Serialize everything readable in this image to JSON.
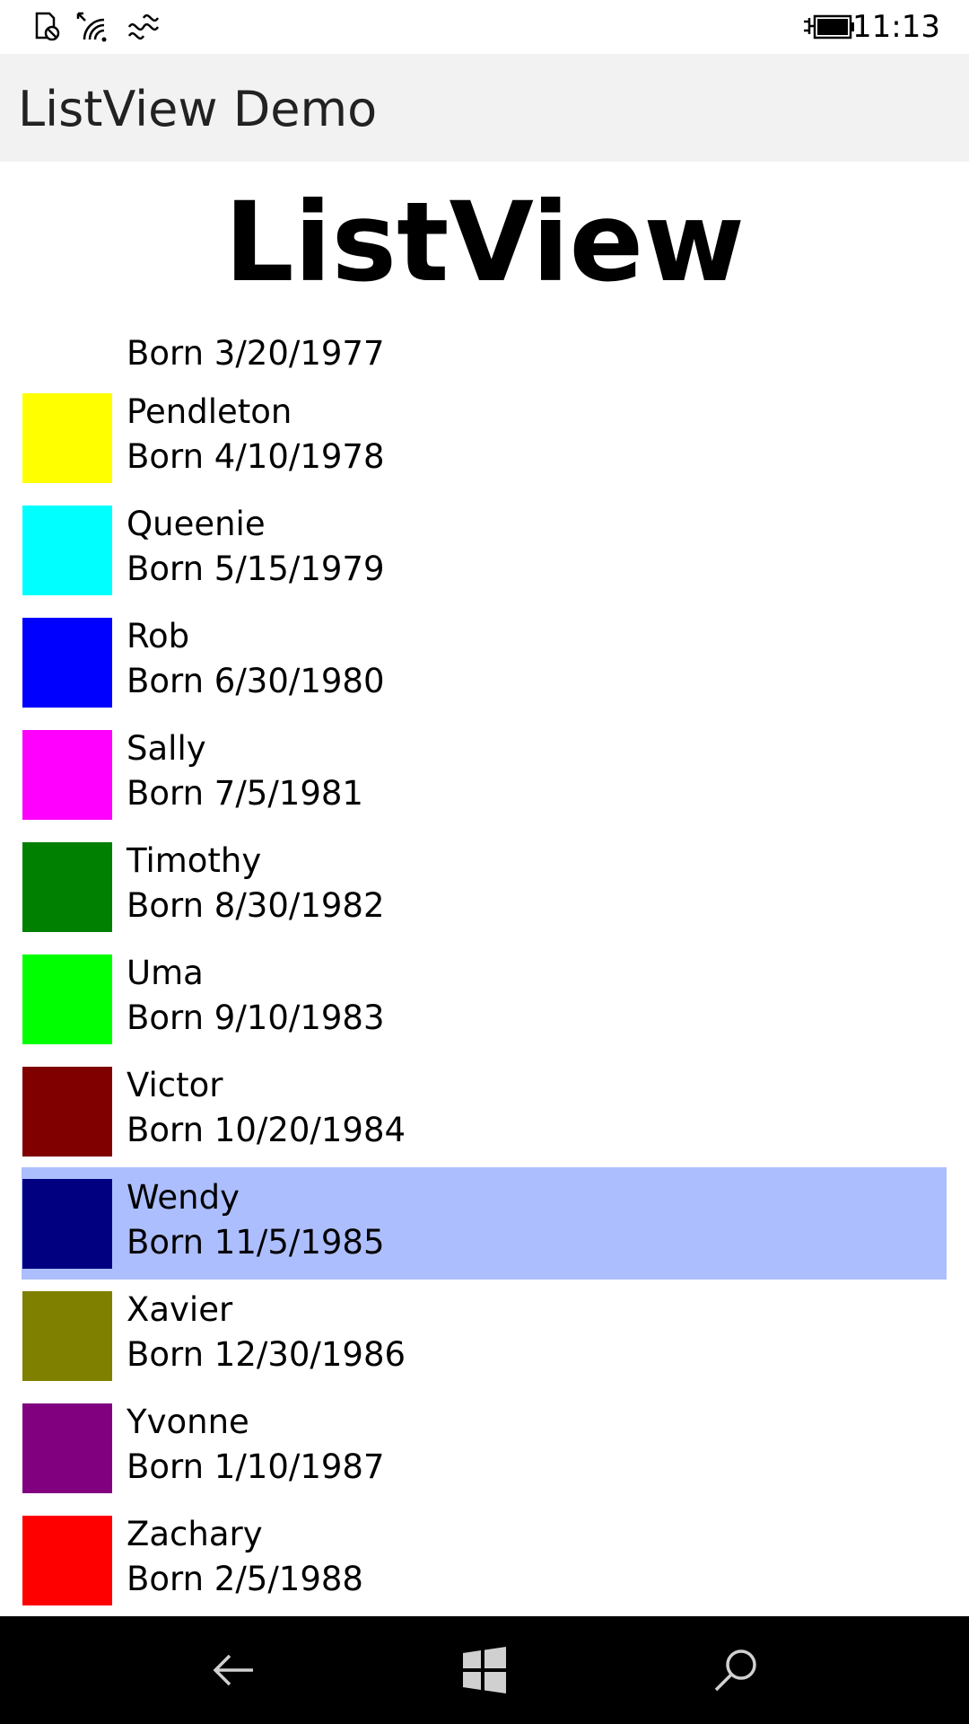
{
  "status_bar": {
    "time": "11:13",
    "icons": [
      "notification-icon",
      "wifi-icon",
      "cellular-icon",
      "battery-charging-icon"
    ]
  },
  "app": {
    "title": "ListView Demo"
  },
  "page": {
    "header": "ListView"
  },
  "list": {
    "partial_item_born": "Born 3/20/1977",
    "items": [
      {
        "name": "Pendleton",
        "born": "Born 4/10/1978",
        "color": "#ffff00"
      },
      {
        "name": "Queenie",
        "born": "Born 5/15/1979",
        "color": "#00ffff"
      },
      {
        "name": "Rob",
        "born": "Born 6/30/1980",
        "color": "#0000ff"
      },
      {
        "name": "Sally",
        "born": "Born 7/5/1981",
        "color": "#ff00ff"
      },
      {
        "name": "Timothy",
        "born": "Born 8/30/1982",
        "color": "#008000"
      },
      {
        "name": "Uma",
        "born": "Born 9/10/1983",
        "color": "#00ff00"
      },
      {
        "name": "Victor",
        "born": "Born 10/20/1984",
        "color": "#800000"
      },
      {
        "name": "Wendy",
        "born": "Born 11/5/1985",
        "color": "#000080",
        "selected": true
      },
      {
        "name": "Xavier",
        "born": "Born 12/30/1986",
        "color": "#808000"
      },
      {
        "name": "Yvonne",
        "born": "Born 1/10/1987",
        "color": "#800080"
      },
      {
        "name": "Zachary",
        "born": "Born 2/5/1988",
        "color": "#ff0000"
      }
    ],
    "selection_color": "#adbefe"
  },
  "nav_bar": {
    "buttons": [
      "back-icon",
      "windows-start-icon",
      "search-icon"
    ]
  }
}
